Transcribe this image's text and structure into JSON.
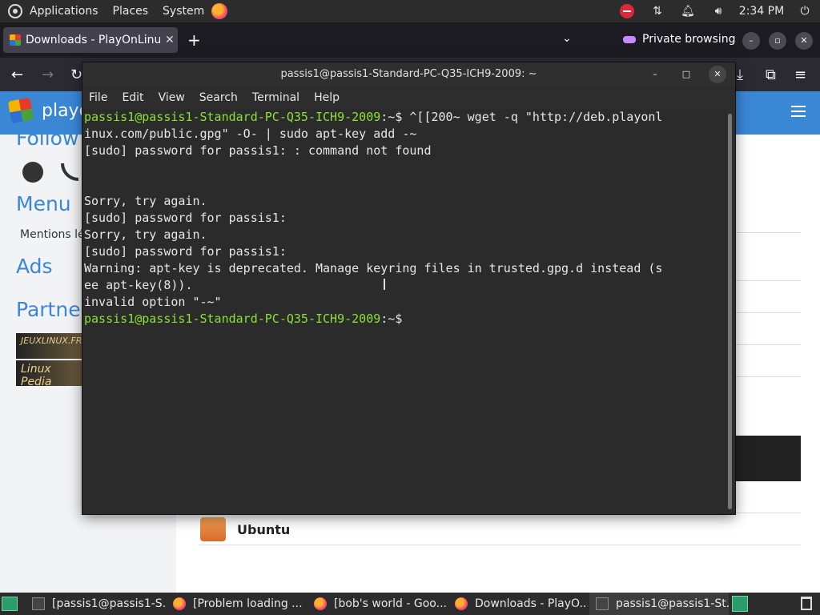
{
  "top_panel": {
    "menus": [
      "Applications",
      "Places",
      "System"
    ],
    "clock": "2:34 PM"
  },
  "browser": {
    "tab_title": "Downloads - PlayOnLinux",
    "private_label": "Private browsing",
    "page": {
      "site_name": "playo",
      "sidebar": {
        "follow_heading": "Follow",
        "menu_heading": "Menu",
        "menu_item": "Mentions lé",
        "ads_heading": "Ads",
        "partners_heading": "Partner",
        "partner1": "JEUXLINUX.FR",
        "partner2": "Linux Pedia"
      },
      "ubuntu_label": "Ubuntu"
    }
  },
  "terminal": {
    "title": "passis1@passis1-Standard-PC-Q35-ICH9-2009: ~",
    "menus": [
      "File",
      "Edit",
      "View",
      "Search",
      "Terminal",
      "Help"
    ],
    "prompt": "passis1@passis1-Standard-PC-Q35-ICH9-2009",
    "lines": [
      {
        "prompt": "passis1@passis1-Standard-PC-Q35-ICH9-2009",
        "text": ":~$ ^[[200~ wget -q \"http://deb.playonl"
      },
      {
        "prompt": "",
        "text": "inux.com/public.gpg\" -O- | sudo apt-key add -~"
      },
      {
        "prompt": "",
        "text": "[sudo] password for passis1: : command not found"
      },
      {
        "prompt": "",
        "text": ""
      },
      {
        "prompt": "",
        "text": ""
      },
      {
        "prompt": "",
        "text": "Sorry, try again."
      },
      {
        "prompt": "",
        "text": "[sudo] password for passis1:"
      },
      {
        "prompt": "",
        "text": "Sorry, try again."
      },
      {
        "prompt": "",
        "text": "[sudo] password for passis1:"
      },
      {
        "prompt": "",
        "text": "Warning: apt-key is deprecated. Manage keyring files in trusted.gpg.d instead (s"
      },
      {
        "prompt": "",
        "text": "ee apt-key(8))."
      },
      {
        "prompt": "",
        "text": "invalid option \"-~\""
      },
      {
        "prompt": "passis1@passis1-Standard-PC-Q35-ICH9-2009",
        "text": ":~$ "
      }
    ]
  },
  "taskbar": {
    "tasks": [
      {
        "label": "[passis1@passis1-S...",
        "icon": "terminal-icon"
      },
      {
        "label": "[Problem loading ...",
        "icon": "firefox-icon"
      },
      {
        "label": "[bob's world - Goo...",
        "icon": "firefox-icon"
      },
      {
        "label": "Downloads - PlayO...",
        "icon": "firefox-icon"
      },
      {
        "label": "passis1@passis1-St...",
        "icon": "terminal-icon"
      }
    ]
  }
}
